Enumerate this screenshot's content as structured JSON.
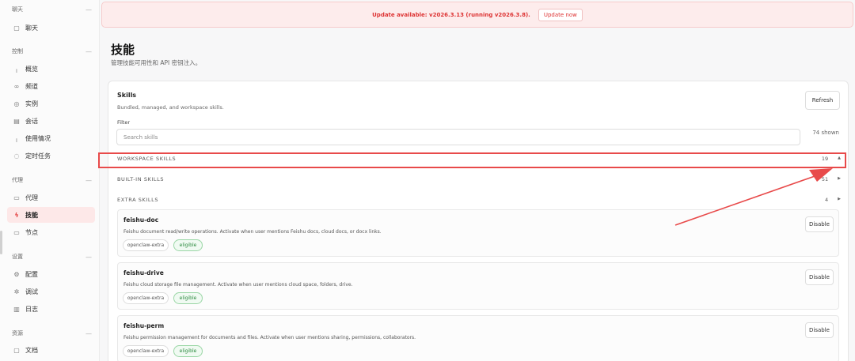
{
  "sidebar": {
    "sections": [
      {
        "title": "聊天",
        "items": [
          {
            "label": "聊天",
            "icon": "chat-bubble-icon",
            "glyph": "▢"
          }
        ]
      },
      {
        "title": "控制",
        "items": [
          {
            "label": "概览",
            "icon": "bar-chart-icon",
            "glyph": "╷"
          },
          {
            "label": "频道",
            "icon": "link-icon",
            "glyph": "∞"
          },
          {
            "label": "实例",
            "icon": "broadcast-icon",
            "glyph": "◎"
          },
          {
            "label": "会话",
            "icon": "document-icon",
            "glyph": "▤"
          },
          {
            "label": "使用情况",
            "icon": "usage-chart-icon",
            "glyph": "╷"
          },
          {
            "label": "定时任务",
            "icon": "clock-icon",
            "glyph": "◌"
          }
        ]
      },
      {
        "title": "代理",
        "items": [
          {
            "label": "代理",
            "icon": "folder-icon",
            "glyph": "▭"
          },
          {
            "label": "技能",
            "icon": "lightning-icon",
            "glyph": "ϟ",
            "active": true
          },
          {
            "label": "节点",
            "icon": "monitor-icon",
            "glyph": "▭"
          }
        ]
      },
      {
        "title": "设置",
        "items": [
          {
            "label": "配置",
            "icon": "gear-icon",
            "glyph": "⚙"
          },
          {
            "label": "调试",
            "icon": "bug-icon",
            "glyph": "✲"
          },
          {
            "label": "日志",
            "icon": "log-icon",
            "glyph": "▥"
          }
        ]
      },
      {
        "title": "资源",
        "items": [
          {
            "label": "文档",
            "icon": "book-icon",
            "glyph": "▢"
          }
        ]
      }
    ],
    "collapse_glyph": "—"
  },
  "banner": {
    "text": "Update available: v2026.3.13 (running v2026.3.8).",
    "button": "Update now"
  },
  "page": {
    "title": "技能",
    "subtitle": "管理技能可用性和 API 密钥注入。"
  },
  "skills_card": {
    "title": "Skills",
    "description": "Bundled, managed, and workspace skills.",
    "refresh": "Refresh",
    "filter_label": "Filter",
    "search_placeholder": "Search skills",
    "shown": "74 shown",
    "groups": [
      {
        "name": "WORKSPACE SKILLS",
        "count": "19",
        "caret": "▲"
      },
      {
        "name": "BUILT-IN SKILLS",
        "count": "51",
        "caret": "▶"
      },
      {
        "name": "EXTRA SKILLS",
        "count": "4",
        "caret": "▶"
      }
    ],
    "skills": [
      {
        "name": "feishu-doc",
        "description": "Feishu document read/write operations. Activate when user mentions Feishu docs, cloud docs, or docx links.",
        "source": "openclaw-extra",
        "status": "eligible",
        "action": "Disable"
      },
      {
        "name": "feishu-drive",
        "description": "Feishu cloud storage file management. Activate when user mentions cloud space, folders, drive.",
        "source": "openclaw-extra",
        "status": "eligible",
        "action": "Disable"
      },
      {
        "name": "feishu-perm",
        "description": "Feishu permission management for documents and files. Activate when user mentions sharing, permissions, collaborators.",
        "source": "openclaw-extra",
        "status": "eligible",
        "action": "Disable"
      }
    ]
  },
  "colors": {
    "accent": "#e23b3b",
    "annotation": "#e84a4a",
    "eligible": "#2a8a3e"
  }
}
